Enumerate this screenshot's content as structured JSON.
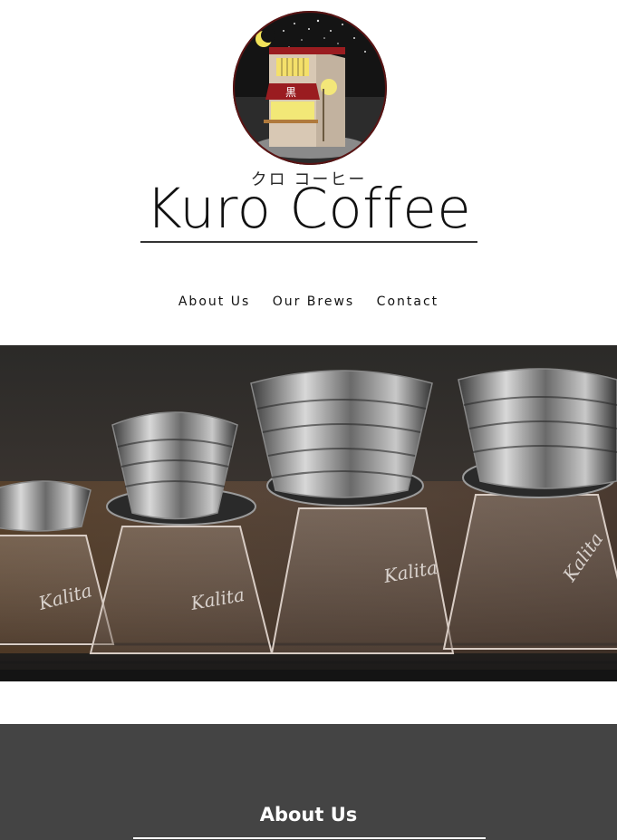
{
  "brand": {
    "katakana": "クロ コーヒー",
    "name": "Kuro Coffee",
    "shop_sign": "黒"
  },
  "nav": {
    "items": [
      {
        "label": "About Us"
      },
      {
        "label": "Our Brews"
      },
      {
        "label": "Contact"
      }
    ]
  },
  "hero": {
    "brewer_brand": "Kalita"
  },
  "sections": {
    "about_title": "About Us"
  },
  "colors": {
    "page_bg": "#ffffff",
    "section_bg": "#444444",
    "text_dark": "#111111",
    "awning_red": "#9a1c20"
  }
}
